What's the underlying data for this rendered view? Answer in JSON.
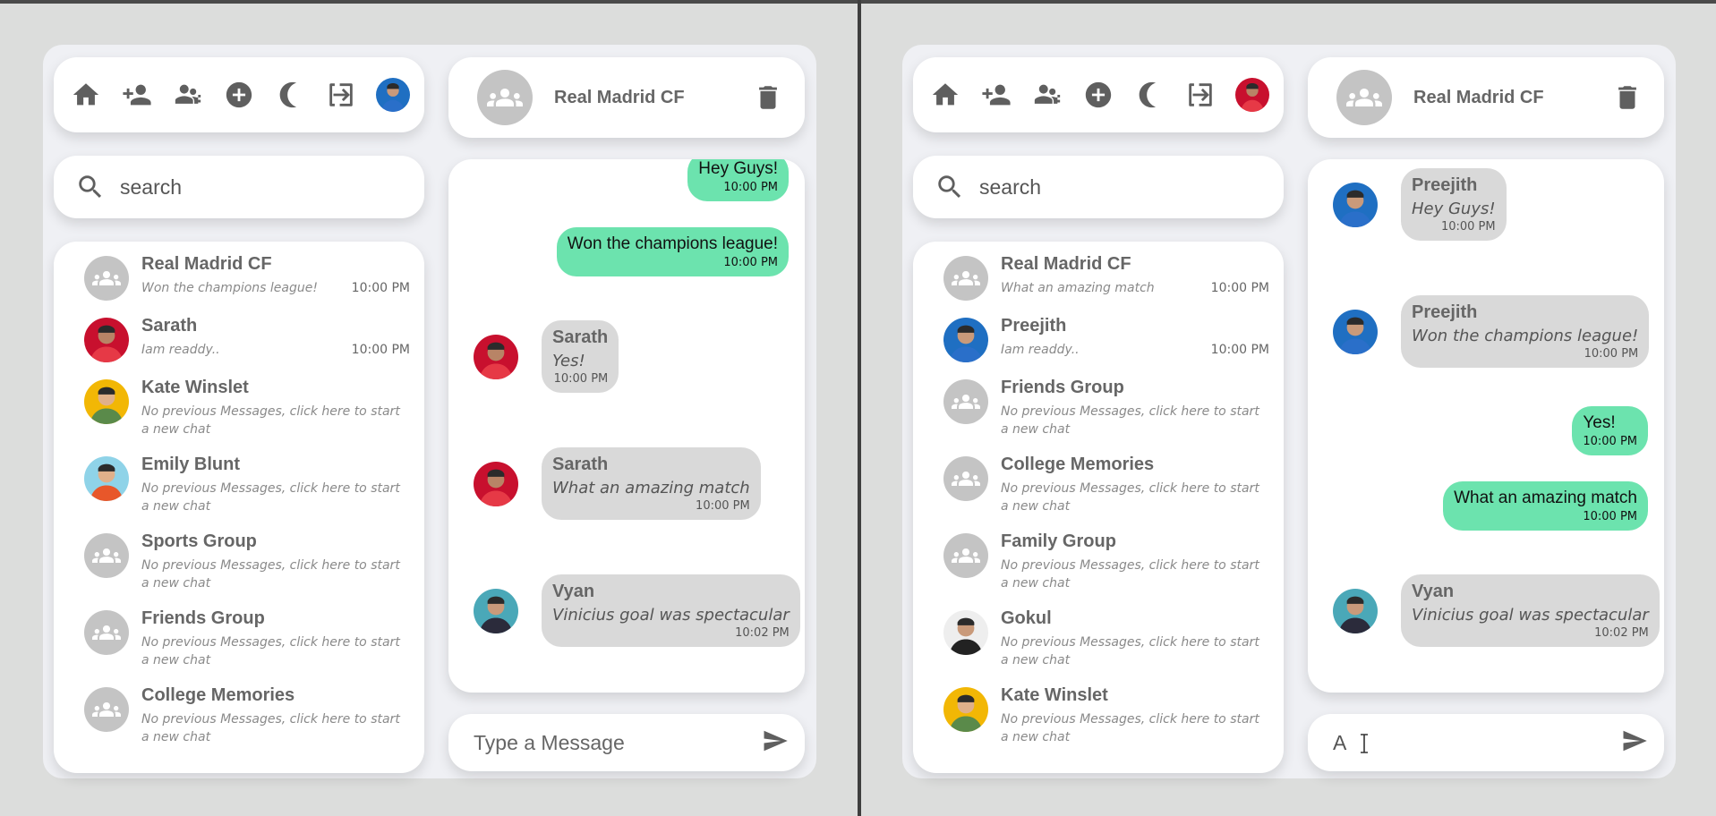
{
  "search": {
    "placeholder": "search"
  },
  "compose": {
    "placeholder": "Type a Message"
  },
  "left": {
    "chat_title": "Real Madrid CF",
    "contacts": [
      {
        "name": "Real Madrid CF",
        "preview": "Won the champions league!",
        "time": "10:00 PM",
        "avatar": "group"
      },
      {
        "name": "Sarath",
        "preview": "Iam readdy..",
        "time": "10:00 PM",
        "avatar": "red"
      },
      {
        "name": "Kate Winslet",
        "preview": "No previous Messages, click here to start a new chat",
        "time": "",
        "avatar": "yellow"
      },
      {
        "name": "Emily Blunt",
        "preview": "No previous Messages, click here to start a new chat",
        "time": "",
        "avatar": "orange"
      },
      {
        "name": "Sports Group",
        "preview": "No previous Messages, click here to start a new chat",
        "time": "",
        "avatar": "group"
      },
      {
        "name": "Friends Group",
        "preview": "No previous Messages, click here to start a new chat",
        "time": "",
        "avatar": "group"
      },
      {
        "name": "College Memories",
        "preview": "No previous Messages, click here to start a new chat",
        "time": "",
        "avatar": "group"
      }
    ],
    "messages": [
      {
        "text": "Hey Guys!",
        "time": "10:00 PM",
        "mine": true
      },
      {
        "text": "Won the champions league!",
        "time": "10:00 PM",
        "mine": true
      },
      {
        "sender": "Sarath",
        "text": "Yes!",
        "time": "10:00 PM",
        "mine": false
      },
      {
        "sender": "Sarath",
        "text": "What an amazing match",
        "time": "10:00 PM",
        "mine": false
      },
      {
        "sender": "Vyan",
        "text": "Vinicius goal was spectacular",
        "time": "10:02 PM",
        "mine": false
      }
    ],
    "compose_value": ""
  },
  "right": {
    "chat_title": "Real Madrid CF",
    "contacts": [
      {
        "name": "Real Madrid CF",
        "preview": "What an amazing match",
        "time": "10:00 PM",
        "avatar": "group"
      },
      {
        "name": "Preejith",
        "preview": "Iam readdy..",
        "time": "10:00 PM",
        "avatar": "blue"
      },
      {
        "name": "Friends Group",
        "preview": "No previous Messages, click here to start a new chat",
        "time": "",
        "avatar": "group"
      },
      {
        "name": "College Memories",
        "preview": "No previous Messages, click here to start a new chat",
        "time": "",
        "avatar": "group"
      },
      {
        "name": "Family Group",
        "preview": "No previous Messages, click here to start a new chat",
        "time": "",
        "avatar": "group"
      },
      {
        "name": "Gokul",
        "preview": "No previous Messages, click here to start a new chat",
        "time": "",
        "avatar": "black"
      },
      {
        "name": "Kate Winslet",
        "preview": "No previous Messages, click here to start a new chat",
        "time": "",
        "avatar": "yellow"
      }
    ],
    "messages": [
      {
        "sender": "Preejith",
        "text": "Hey Guys!",
        "time": "10:00 PM",
        "mine": false
      },
      {
        "sender": "Preejith",
        "text": "Won the champions league!",
        "time": "10:00 PM",
        "mine": false
      },
      {
        "text": "Yes!",
        "time": "10:00 PM",
        "mine": true
      },
      {
        "text": "What an amazing match",
        "time": "10:00 PM",
        "mine": true
      },
      {
        "sender": "Vyan",
        "text": "Vinicius goal was spectacular",
        "time": "10:02 PM",
        "mine": false
      }
    ],
    "compose_value": "A"
  },
  "colors": {
    "bubble_mine": "#6ce3ae",
    "bubble_other": "#d9d9d9",
    "icon": "#5f5f5f",
    "group_avatar": "#c4c4c4"
  },
  "icons": [
    "home-icon",
    "add-user-icon",
    "add-group-icon",
    "plus-circle-icon",
    "moon-icon",
    "logout-icon",
    "profile-avatar",
    "search-icon",
    "trash-icon",
    "send-icon"
  ]
}
